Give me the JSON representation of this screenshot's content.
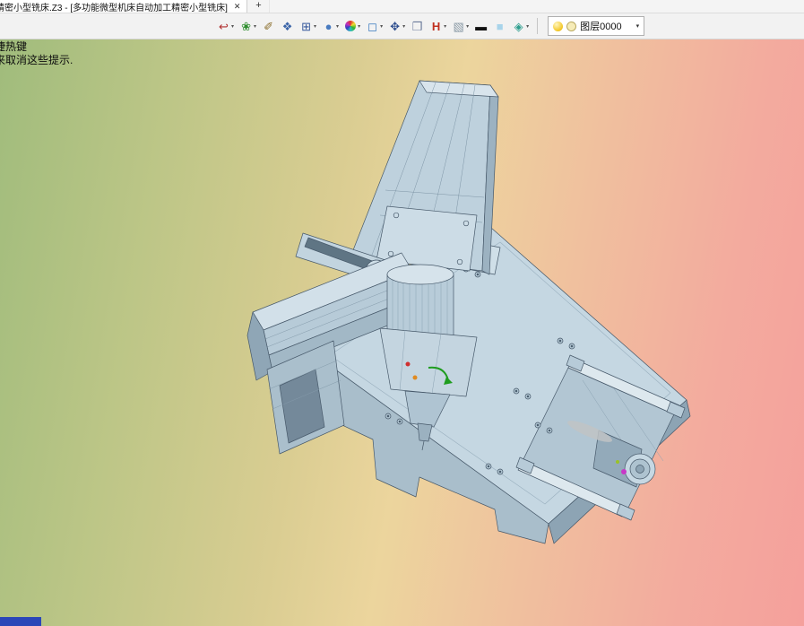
{
  "window": {
    "tab_title": "精密小型铣床.Z3 - [多功能微型机床自动加工精密小型铣床]",
    "close_label": "✕",
    "new_tab_label": "+"
  },
  "toolbar": {
    "caret": "▾",
    "buttons": [
      {
        "name": "export",
        "glyph": "↩"
      },
      {
        "name": "render",
        "glyph": "❀"
      },
      {
        "name": "pen",
        "glyph": "✐"
      },
      {
        "name": "solid-cube",
        "glyph": "❖"
      },
      {
        "name": "boolean-cube",
        "glyph": "⊞"
      },
      {
        "name": "shaded-sphere",
        "glyph": "●"
      },
      {
        "name": "color-wheel",
        "glyph": ""
      },
      {
        "name": "section-frame",
        "glyph": "◻"
      },
      {
        "name": "move",
        "glyph": "✥"
      },
      {
        "name": "image-plane",
        "glyph": "❒"
      },
      {
        "name": "beam",
        "glyph": "H"
      },
      {
        "name": "gray-box",
        "glyph": "▧"
      },
      {
        "name": "line-width",
        "glyph": "▬"
      },
      {
        "name": "face-color",
        "glyph": "■"
      },
      {
        "name": "layers",
        "glyph": "◈"
      }
    ],
    "layer_combo": {
      "value": "图层0000"
    }
  },
  "viewport": {
    "hint_line1": "捷热键",
    "hint_line2": "来取消这些提示.",
    "colors": {
      "bg_left": "#a0bc7c",
      "bg_mid": "#ecd59d",
      "bg_right": "#f5a09c",
      "model": "#bed1dd",
      "bottom_fragment": "#2a46b8"
    }
  }
}
